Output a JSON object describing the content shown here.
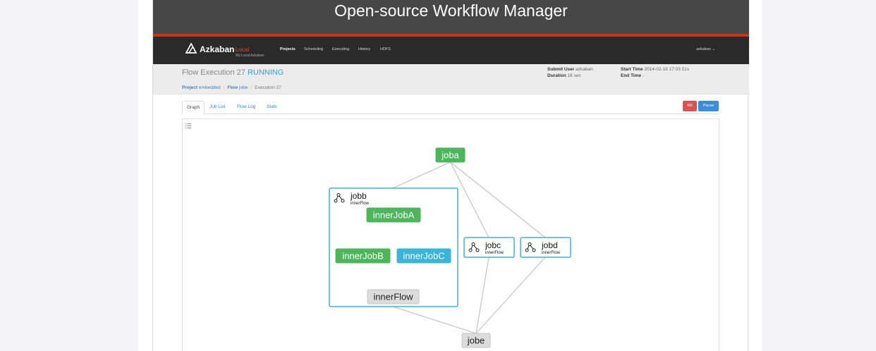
{
  "banner": {
    "title": "Open-source Workflow Manager"
  },
  "navbar": {
    "brand": "Azkaban",
    "env": "Local",
    "subtitle": "My Local Azkaban",
    "items": [
      "Projects",
      "Scheduling",
      "Executing",
      "History",
      "HDFS"
    ],
    "active": "Projects",
    "user": "azkaban ⌄"
  },
  "execution": {
    "title": "Flow Execution 27",
    "status": "RUNNING",
    "submit_user_label": "Submit User",
    "submit_user": "azkaban",
    "duration_label": "Duration",
    "duration": "16 sec",
    "start_time_label": "Start Time",
    "start_time": "2014-02-19 17:03 51s",
    "end_time_label": "End Time",
    "end_time": "-"
  },
  "breadcrumb": {
    "project_label": "Project",
    "project": "embedded",
    "flow_label": "Flow",
    "flow": "jobe",
    "execution": "Execution 27",
    "sep": "/"
  },
  "tabs": [
    "Graph",
    "Job List",
    "Flow Log",
    "Stats"
  ],
  "buttons": {
    "kill": "Kill",
    "pause": "Pause"
  },
  "graph": {
    "nodes": [
      {
        "id": "joba",
        "label": "joba",
        "status": "succeeded"
      },
      {
        "id": "innerJobA",
        "label": "innerJobA",
        "status": "succeeded"
      },
      {
        "id": "innerJobB",
        "label": "innerJobB",
        "status": "succeeded"
      },
      {
        "id": "innerJobC",
        "label": "innerJobC",
        "status": "running"
      },
      {
        "id": "innerFlow",
        "label": "innerFlow",
        "status": "ready"
      },
      {
        "id": "jobe",
        "label": "jobe",
        "status": "ready"
      }
    ],
    "flows": [
      {
        "id": "jobb",
        "label": "jobb",
        "sublabel": "innerFlow"
      },
      {
        "id": "jobc",
        "label": "jobc",
        "sublabel": "innerFlow"
      },
      {
        "id": "jobd",
        "label": "jobd",
        "sublabel": "innerFlow"
      }
    ],
    "edges": [
      [
        "joba",
        "jobb"
      ],
      [
        "joba",
        "jobc"
      ],
      [
        "joba",
        "jobd"
      ],
      [
        "innerJobA",
        "innerJobB"
      ],
      [
        "innerJobA",
        "innerJobC"
      ],
      [
        "innerJobB",
        "innerFlow"
      ],
      [
        "innerJobC",
        "innerFlow"
      ],
      [
        "jobb",
        "jobe"
      ],
      [
        "jobc",
        "jobe"
      ],
      [
        "jobd",
        "jobe"
      ]
    ]
  },
  "colors": {
    "succeeded": "#4cb75a",
    "running": "#3ab5d8",
    "ready": "#dcdcdc",
    "flow_border": "#3ab5d8",
    "edge": "#c8c8c8",
    "banner_accent": "#c9331f"
  }
}
